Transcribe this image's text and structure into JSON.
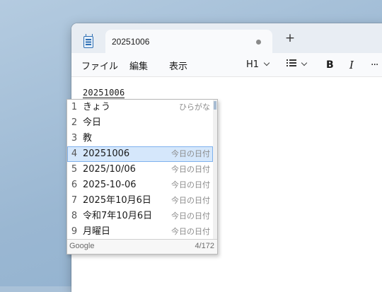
{
  "tab": {
    "title": "20251006",
    "new_tab_glyph": "+"
  },
  "menu": [
    "ファイル",
    "編集",
    "表示"
  ],
  "toolbar": {
    "heading_label": "H1",
    "list_icon": "bulleted-list-icon",
    "bold_label": "B",
    "italic_label": "I",
    "more_label": "···"
  },
  "editor": {
    "typed_text": "20251006"
  },
  "ime": {
    "candidates": [
      {
        "num": "1",
        "text": "きょう",
        "annotation": "ひらがな"
      },
      {
        "num": "2",
        "text": "今日",
        "annotation": ""
      },
      {
        "num": "3",
        "text": "教",
        "annotation": ""
      },
      {
        "num": "4",
        "text": "20251006",
        "annotation": "今日の日付"
      },
      {
        "num": "5",
        "text": "2025/10/06",
        "annotation": "今日の日付"
      },
      {
        "num": "6",
        "text": "2025-10-06",
        "annotation": "今日の日付"
      },
      {
        "num": "7",
        "text": "2025年10月6日",
        "annotation": "今日の日付"
      },
      {
        "num": "8",
        "text": "令和7年10月6日",
        "annotation": "今日の日付"
      },
      {
        "num": "9",
        "text": "月曜日",
        "annotation": "今日の日付"
      }
    ],
    "selected_index": 3,
    "brand": "Google",
    "count": "4/172"
  },
  "colors": {
    "selection_bg": "#d5e7fb",
    "selection_border": "#7fb2ee",
    "accent": "#2f6fb4"
  }
}
